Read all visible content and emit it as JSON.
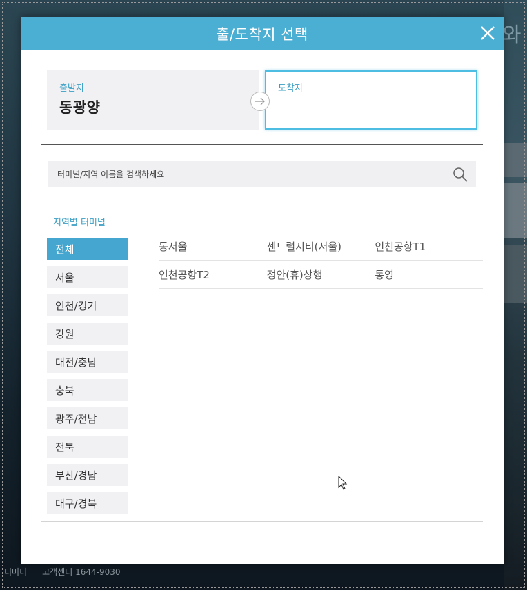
{
  "dialog": {
    "title": "출/도착지 선택",
    "close_icon": "close-icon"
  },
  "route": {
    "departure_label": "출발지",
    "departure_value": "동광양",
    "arrival_label": "도착지",
    "arrival_value": ""
  },
  "search": {
    "placeholder": "터미널/지역 이름을 검색하세요",
    "value": ""
  },
  "regions_title": "지역별 터미널",
  "regions": [
    {
      "label": "전체",
      "active": true
    },
    {
      "label": "서울",
      "active": false
    },
    {
      "label": "인천/경기",
      "active": false
    },
    {
      "label": "강원",
      "active": false
    },
    {
      "label": "대전/충남",
      "active": false
    },
    {
      "label": "충북",
      "active": false
    },
    {
      "label": "광주/전남",
      "active": false
    },
    {
      "label": "전북",
      "active": false
    },
    {
      "label": "부산/경남",
      "active": false
    },
    {
      "label": "대구/경북",
      "active": false
    }
  ],
  "terminals": [
    [
      "동서울",
      "센트럴시티(서울)",
      "인천공항T1"
    ],
    [
      "인천공항T2",
      "정안(휴)상행",
      "통영"
    ]
  ],
  "background": {
    "footer_items": [
      "티머니",
      "고객센터 1644-9030"
    ],
    "edge_char": "와"
  },
  "colors": {
    "header": "#4baed3",
    "accent": "#3a9ec4",
    "active_region": "#45a6cf"
  }
}
